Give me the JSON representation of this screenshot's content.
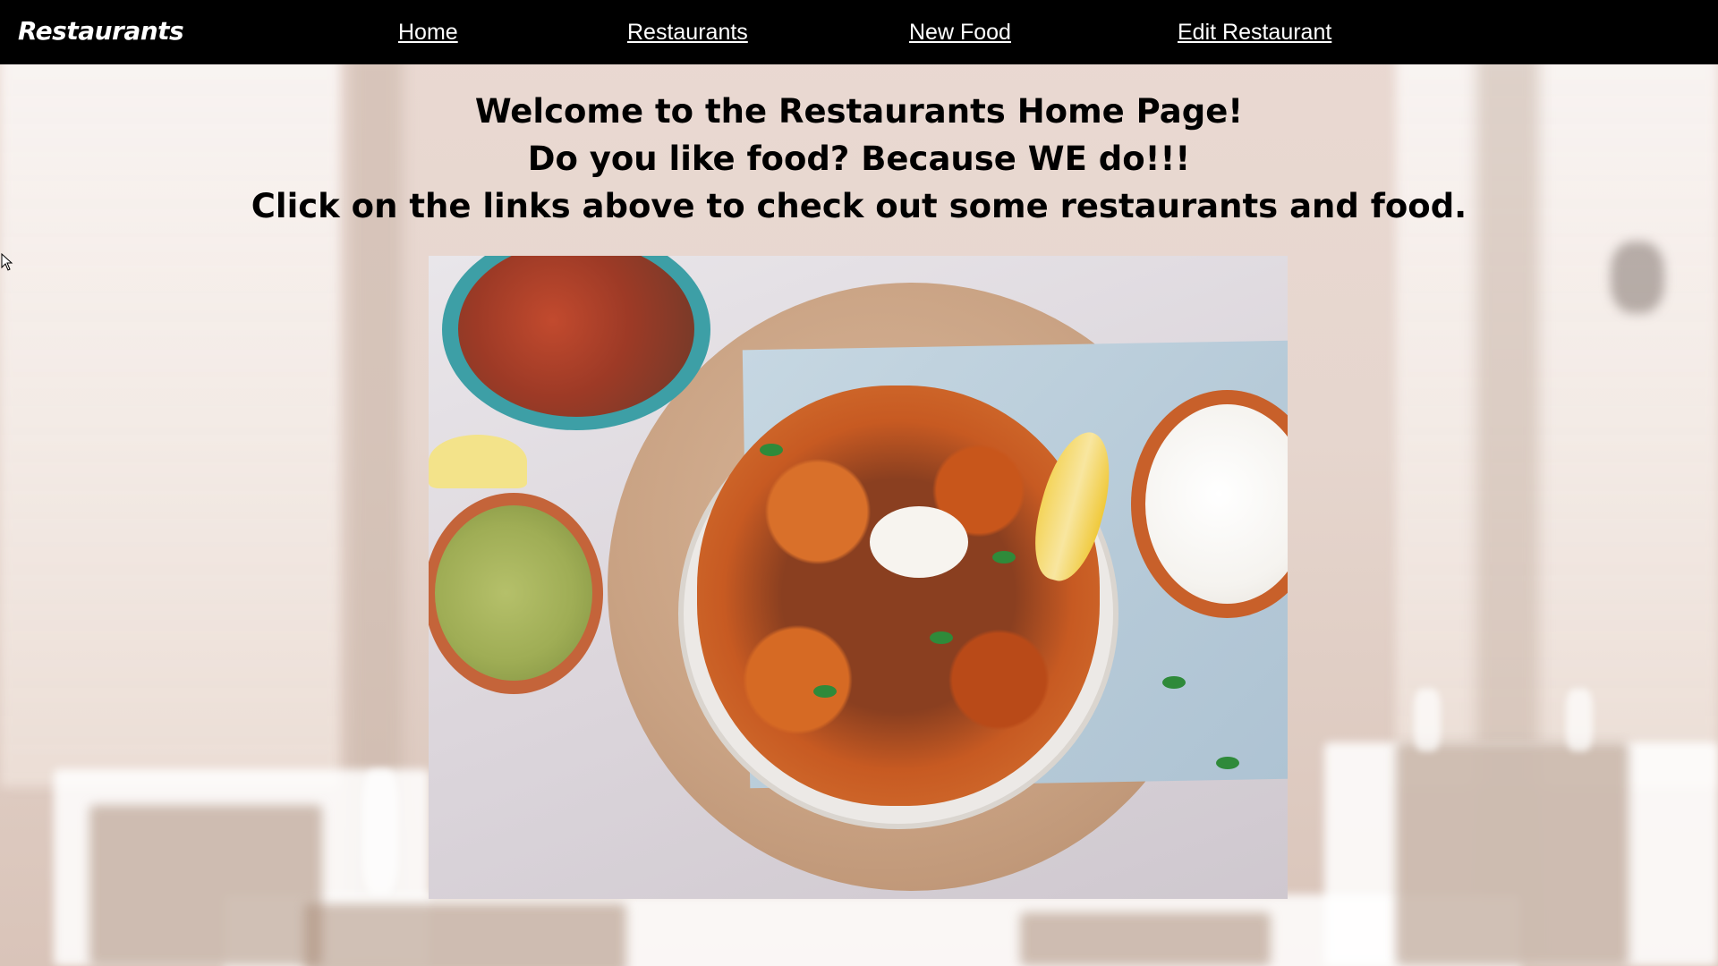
{
  "navbar": {
    "brand": "Restaurants",
    "links": [
      {
        "label": "Home"
      },
      {
        "label": "Restaurants"
      },
      {
        "label": "New Food"
      },
      {
        "label": "Edit Restaurant"
      }
    ]
  },
  "main": {
    "heading_lines": [
      "Welcome to the Restaurants Home Page!",
      "Do you like food? Because WE do!!!",
      "Click on the links above to check out some restaurants and food."
    ]
  },
  "colors": {
    "navbar_bg": "#000000",
    "nav_text": "#ffffff",
    "heading_text": "#000000"
  },
  "icons": [
    "mouse-pointer-icon"
  ]
}
